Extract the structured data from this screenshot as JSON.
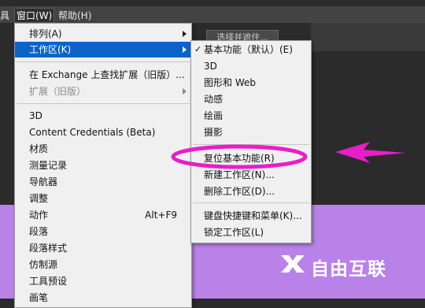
{
  "menubar": {
    "items": [
      {
        "label": "具"
      },
      {
        "label": "窗口(W)"
      },
      {
        "label": "帮助(H)"
      }
    ]
  },
  "toolbar": {
    "button_label": "选择并遮住..."
  },
  "window_menu": {
    "items": [
      {
        "label": "排列(A)"
      },
      {
        "label": "工作区(K)"
      },
      {
        "label": "在 Exchange 上查找扩展（旧版）..."
      },
      {
        "label": "扩展（旧版）"
      },
      {
        "label": "3D"
      },
      {
        "label": "Content Credentials (Beta)"
      },
      {
        "label": "材质"
      },
      {
        "label": "测量记录"
      },
      {
        "label": "导航器"
      },
      {
        "label": "调整"
      },
      {
        "label": "动作",
        "shortcut": "Alt+F9"
      },
      {
        "label": "段落"
      },
      {
        "label": "段落样式"
      },
      {
        "label": "仿制源"
      },
      {
        "label": "工具预设"
      },
      {
        "label": "画笔"
      }
    ]
  },
  "workspace_submenu": {
    "check_mark": "✓",
    "items": [
      {
        "label": "基本功能（默认）(E)"
      },
      {
        "label": "3D"
      },
      {
        "label": "图形和 Web"
      },
      {
        "label": "动感"
      },
      {
        "label": "绘画"
      },
      {
        "label": "摄影"
      },
      {
        "label": "复位基本功能(R)"
      },
      {
        "label": "新建工作区(N)..."
      },
      {
        "label": "删除工作区(D)..."
      },
      {
        "label": "键盘快捷键和菜单(K)..."
      },
      {
        "label": "锁定工作区(L)"
      }
    ]
  },
  "annotation": {
    "color": "#e81ec8"
  },
  "watermark": {
    "text": "自由互联"
  },
  "colors": {
    "highlight": "#0a64c8",
    "menu_bg": "#f0f0f0",
    "purple_bg": "#b882e8"
  }
}
